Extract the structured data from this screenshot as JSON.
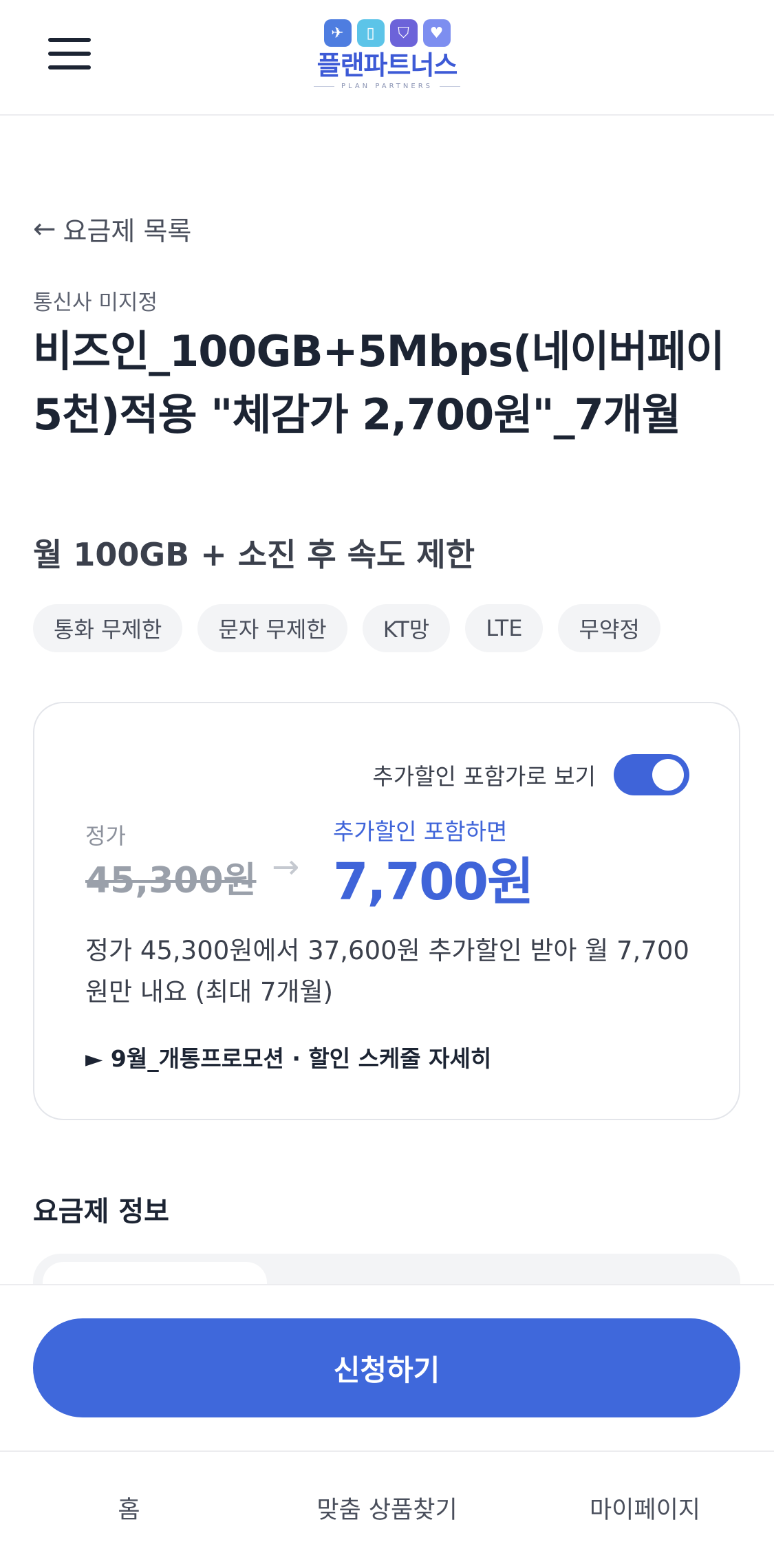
{
  "header": {
    "logo_name": "플랜파트너스",
    "logo_sub": "PLAN PARTNERS",
    "logo_icons": [
      "airplane-icon",
      "phone-icon",
      "shield-icon",
      "heart-hand-icon"
    ],
    "logo_icon_colors": [
      "#4e7de0",
      "#5cc4e8",
      "#6c63d9",
      "#7d8ef0"
    ]
  },
  "nav_back": {
    "arrow": "←",
    "label": "요금제 목록"
  },
  "plan": {
    "carrier": "통신사 미지정",
    "title": "비즈인_100GB+5Mbps(네이버페이 5천)적용 \"체감가 2,700원\"_7개월",
    "subtitle": "월 100GB + 소진 후 속도 제한",
    "tags": [
      "통화 무제한",
      "문자 무제한",
      "KT망",
      "LTE",
      "무약정"
    ]
  },
  "price_card": {
    "toggle_label": "추가할인 포함가로 보기",
    "toggle_on": true,
    "original_label": "정가",
    "original_price": "45,300원",
    "arrow": "→",
    "discount_label": "추가할인 포함하면",
    "discount_price": "7,700원",
    "description": "정가 45,300원에서 37,600원 추가할인 받아 월 7,700원만 내요 (최대 7개월)",
    "promo_link": "► 9월_개통프로모션 · 할인 스케줄 자세히"
  },
  "section": {
    "title": "요금제 정보"
  },
  "apply_button": "신청하기",
  "bottom_nav": [
    "홈",
    "맞춤 상품찾기",
    "마이페이지"
  ],
  "colors": {
    "accent": "#3f64d9",
    "text": "#1c2433",
    "tag_bg": "#f3f4f6"
  }
}
